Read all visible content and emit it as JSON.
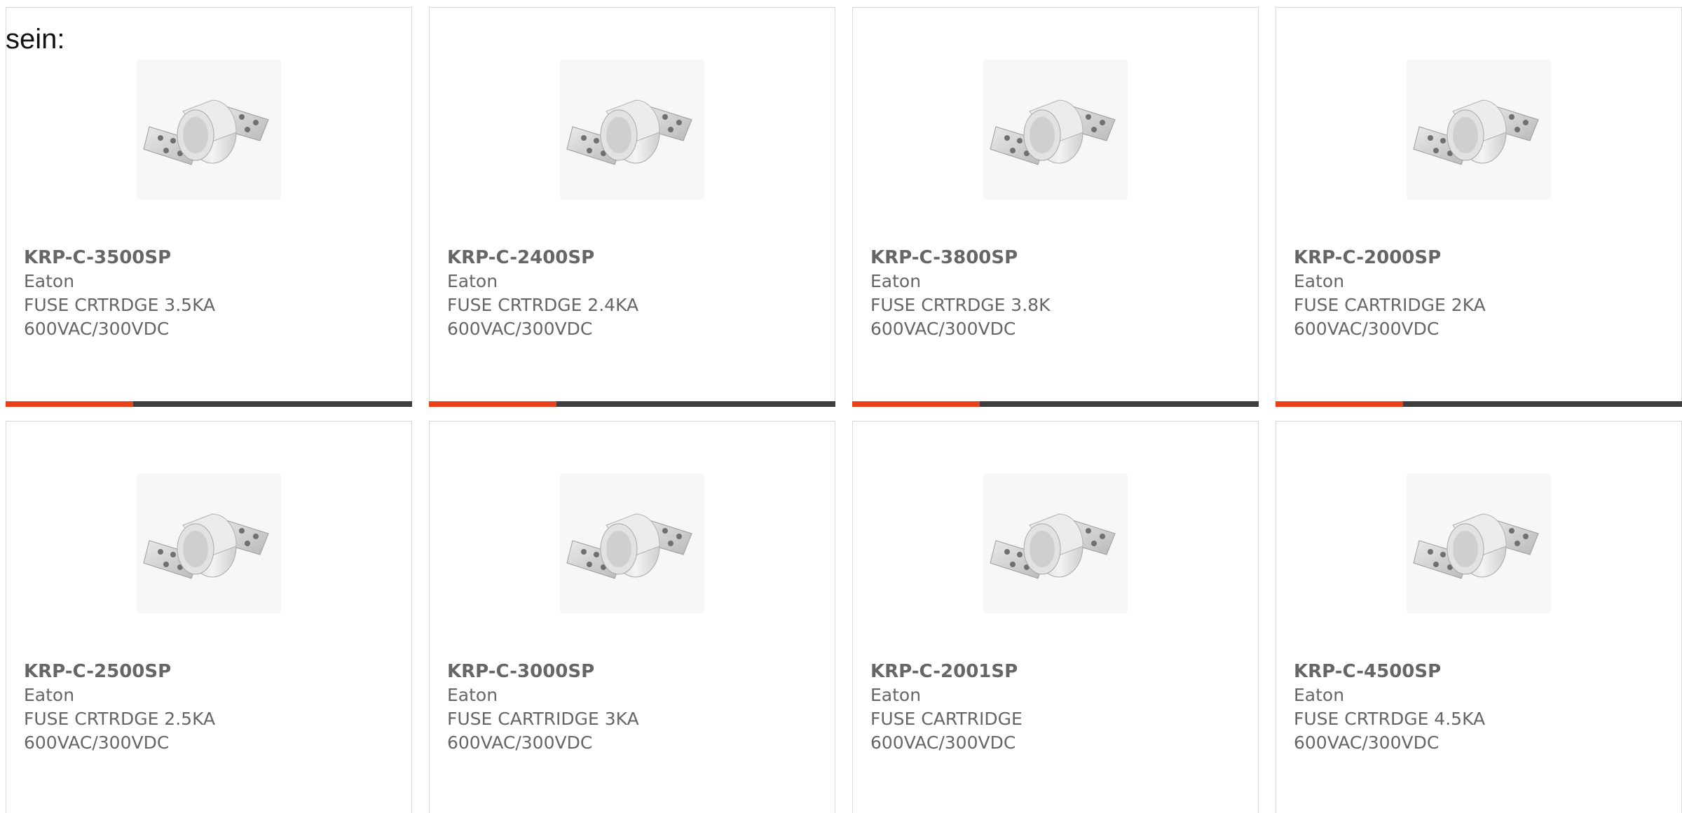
{
  "intro_text": "sein:",
  "colors": {
    "accent": "#e8411b",
    "bar": "#3d3d3d",
    "text": "#666666",
    "border": "#d9d9d9"
  },
  "products": [
    {
      "part": "KRP-C-3500SP",
      "manufacturer": "Eaton",
      "description": "FUSE CRTRDGE 3.5KA\n600VAC/300VDC",
      "image": "fuse-icon"
    },
    {
      "part": "KRP-C-2400SP",
      "manufacturer": "Eaton",
      "description": "FUSE CRTRDGE 2.4KA\n600VAC/300VDC",
      "image": "fuse-icon"
    },
    {
      "part": "KRP-C-3800SP",
      "manufacturer": "Eaton",
      "description": "FUSE CRTRDGE 3.8K\n600VAC/300VDC",
      "image": "fuse-icon"
    },
    {
      "part": "KRP-C-2000SP",
      "manufacturer": "Eaton",
      "description": "FUSE CARTRIDGE 2KA\n600VAC/300VDC",
      "image": "fuse-icon"
    },
    {
      "part": "KRP-C-2500SP",
      "manufacturer": "Eaton",
      "description": "FUSE CRTRDGE 2.5KA\n600VAC/300VDC",
      "image": "fuse-icon"
    },
    {
      "part": "KRP-C-3000SP",
      "manufacturer": "Eaton",
      "description": "FUSE CARTRIDGE 3KA\n600VAC/300VDC",
      "image": "fuse-icon"
    },
    {
      "part": "KRP-C-2001SP",
      "manufacturer": "Eaton",
      "description": "FUSE CARTRIDGE\n600VAC/300VDC",
      "image": "fuse-icon"
    },
    {
      "part": "KRP-C-4500SP",
      "manufacturer": "Eaton",
      "description": "FUSE CRTRDGE 4.5KA\n600VAC/300VDC",
      "image": "fuse-icon"
    }
  ]
}
